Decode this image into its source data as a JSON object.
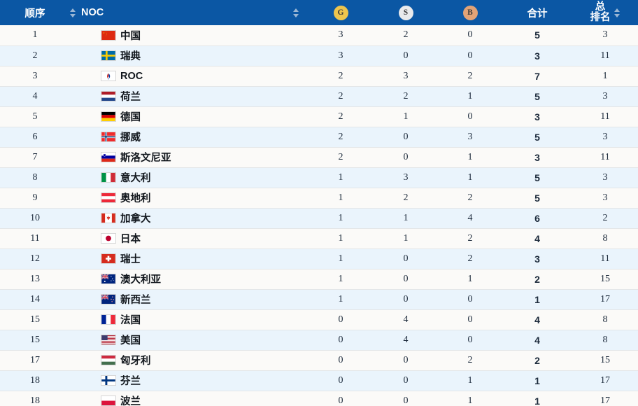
{
  "table": {
    "columns": [
      {
        "key": "rank",
        "label": "顺序",
        "icon": "sort-icon",
        "sortable": true
      },
      {
        "key": "noc",
        "label": "NOC",
        "icon": "sort-icon",
        "sortable": true
      },
      {
        "key": "gold",
        "label": "G",
        "icon": "gold-medal-badge",
        "sortable": false
      },
      {
        "key": "silver",
        "label": "S",
        "icon": "silver-medal-badge",
        "sortable": false
      },
      {
        "key": "bronze",
        "label": "B",
        "icon": "bronze-medal-badge",
        "sortable": false
      },
      {
        "key": "total",
        "label": "合计",
        "icon": null,
        "sortable": false
      },
      {
        "key": "overallrank",
        "label1": "总",
        "label2": "排名",
        "icon": "sort-icon",
        "sortable": true
      }
    ],
    "rows": [
      {
        "rank": "1",
        "flag": "cn",
        "noc": "中国",
        "gold": "3",
        "silver": "2",
        "bronze": "0",
        "total": "5",
        "overallrank": "3"
      },
      {
        "rank": "2",
        "flag": "se",
        "noc": "瑞典",
        "gold": "3",
        "silver": "0",
        "bronze": "0",
        "total": "3",
        "overallrank": "11"
      },
      {
        "rank": "3",
        "flag": "roc",
        "noc": "ROC",
        "gold": "2",
        "silver": "3",
        "bronze": "2",
        "total": "7",
        "overallrank": "1"
      },
      {
        "rank": "4",
        "flag": "nl",
        "noc": "荷兰",
        "gold": "2",
        "silver": "2",
        "bronze": "1",
        "total": "5",
        "overallrank": "3"
      },
      {
        "rank": "5",
        "flag": "de",
        "noc": "德国",
        "gold": "2",
        "silver": "1",
        "bronze": "0",
        "total": "3",
        "overallrank": "11"
      },
      {
        "rank": "6",
        "flag": "no",
        "noc": "挪威",
        "gold": "2",
        "silver": "0",
        "bronze": "3",
        "total": "5",
        "overallrank": "3"
      },
      {
        "rank": "7",
        "flag": "si",
        "noc": "斯洛文尼亚",
        "gold": "2",
        "silver": "0",
        "bronze": "1",
        "total": "3",
        "overallrank": "11"
      },
      {
        "rank": "8",
        "flag": "it",
        "noc": "意大利",
        "gold": "1",
        "silver": "3",
        "bronze": "1",
        "total": "5",
        "overallrank": "3"
      },
      {
        "rank": "9",
        "flag": "at",
        "noc": "奥地利",
        "gold": "1",
        "silver": "2",
        "bronze": "2",
        "total": "5",
        "overallrank": "3"
      },
      {
        "rank": "10",
        "flag": "ca",
        "noc": "加拿大",
        "gold": "1",
        "silver": "1",
        "bronze": "4",
        "total": "6",
        "overallrank": "2"
      },
      {
        "rank": "11",
        "flag": "jp",
        "noc": "日本",
        "gold": "1",
        "silver": "1",
        "bronze": "2",
        "total": "4",
        "overallrank": "8"
      },
      {
        "rank": "12",
        "flag": "ch",
        "noc": "瑞士",
        "gold": "1",
        "silver": "0",
        "bronze": "2",
        "total": "3",
        "overallrank": "11"
      },
      {
        "rank": "13",
        "flag": "au",
        "noc": "澳大利亚",
        "gold": "1",
        "silver": "0",
        "bronze": "1",
        "total": "2",
        "overallrank": "15"
      },
      {
        "rank": "14",
        "flag": "nz",
        "noc": "新西兰",
        "gold": "1",
        "silver": "0",
        "bronze": "0",
        "total": "1",
        "overallrank": "17"
      },
      {
        "rank": "15",
        "flag": "fr",
        "noc": "法国",
        "gold": "0",
        "silver": "4",
        "bronze": "0",
        "total": "4",
        "overallrank": "8"
      },
      {
        "rank": "15",
        "flag": "us",
        "noc": "美国",
        "gold": "0",
        "silver": "4",
        "bronze": "0",
        "total": "4",
        "overallrank": "8"
      },
      {
        "rank": "17",
        "flag": "hu",
        "noc": "匈牙利",
        "gold": "0",
        "silver": "0",
        "bronze": "2",
        "total": "2",
        "overallrank": "15"
      },
      {
        "rank": "18",
        "flag": "fi",
        "noc": "芬兰",
        "gold": "0",
        "silver": "0",
        "bronze": "1",
        "total": "1",
        "overallrank": "17"
      },
      {
        "rank": "18",
        "flag": "pl",
        "noc": "波兰",
        "gold": "0",
        "silver": "0",
        "bronze": "1",
        "total": "1",
        "overallrank": "17"
      }
    ]
  },
  "colors": {
    "header_bg": "#0b57a4",
    "row_odd": "#fbfaf8",
    "row_even": "#eaf4fc",
    "gold": "#edc54e",
    "silver": "#e9eaec",
    "bronze": "#e2a377"
  }
}
